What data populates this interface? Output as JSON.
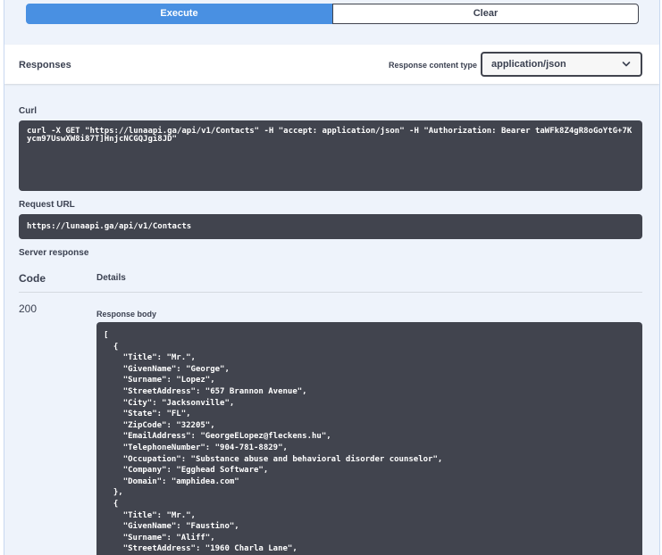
{
  "buttons": {
    "execute": "Execute",
    "clear": "Clear"
  },
  "responses": {
    "title": "Responses",
    "content_type_label": "Response content type",
    "content_type_value": "application/json"
  },
  "curl": {
    "label": "Curl",
    "command": "curl -X GET \"https://lunaapi.ga/api/v1/Contacts\" -H \"accept: application/json\" -H \"Authorization: Bearer taWFk8Z4gR8oGoYtG+7Kycm97UswXW8i87T]HnjcNCGQJgi8JD\""
  },
  "request_url": {
    "label": "Request URL",
    "value": "https://lunaapi.ga/api/v1/Contacts"
  },
  "server_response": {
    "label": "Server response",
    "code_header": "Code",
    "details_header": "Details",
    "code": "200",
    "body_label": "Response body",
    "body": "[\n  {\n    \"Title\": \"Mr.\",\n    \"GivenName\": \"George\",\n    \"Surname\": \"Lopez\",\n    \"StreetAddress\": \"657 Brannon Avenue\",\n    \"City\": \"Jacksonville\",\n    \"State\": \"FL\",\n    \"ZipCode\": \"32205\",\n    \"EmailAddress\": \"GeorgeELopez@fleckens.hu\",\n    \"TelephoneNumber\": \"904-781-8829\",\n    \"Occupation\": \"Substance abuse and behavioral disorder counselor\",\n    \"Company\": \"Egghead Software\",\n    \"Domain\": \"amphidea.com\"\n  },\n  {\n    \"Title\": \"Mr.\",\n    \"GivenName\": \"Faustino\",\n    \"Surname\": \"Aliff\",\n    \"StreetAddress\": \"1960 Charla Lane\","
  },
  "icons": {
    "select_chevron": "chevron-down-icon"
  }
}
